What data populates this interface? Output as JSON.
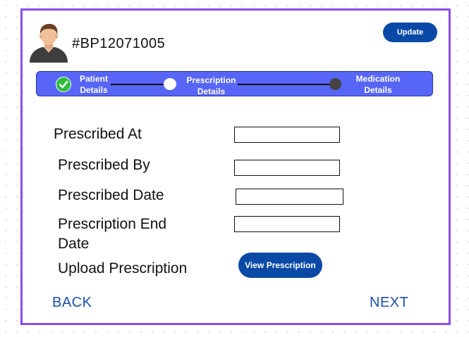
{
  "header": {
    "patient_id": "#BP12071005",
    "update_label": "Update"
  },
  "stepper": {
    "steps": [
      {
        "line1": "Patient",
        "line2": "Details",
        "status": "completed"
      },
      {
        "line1": "Prescription",
        "line2": "Details",
        "status": "current"
      },
      {
        "line1": "Medication",
        "line2": "Details",
        "status": "pending"
      }
    ]
  },
  "form": {
    "prescribed_at": {
      "label": "Prescribed At",
      "value": ""
    },
    "prescribed_by": {
      "label": "Prescribed By",
      "value": ""
    },
    "prescribed_date": {
      "label": "Prescribed Date",
      "value": ""
    },
    "prescription_end_date": {
      "label_line1": "Prescription End",
      "label_line2": "Date",
      "value": ""
    },
    "upload_prescription": {
      "label": "Upload Prescription",
      "button_label": "View  Prescription"
    }
  },
  "footer": {
    "back_label": "BACK",
    "next_label": "NEXT"
  },
  "colors": {
    "frame_border": "#8a4cf0",
    "primary_button": "#0a4aa6",
    "stepper_bg": "#5766f6",
    "check_green": "#2fbd3c",
    "link_blue": "#1c4fa8"
  },
  "icons": {
    "avatar": "user-avatar-icon",
    "step_completed": "check-icon"
  }
}
